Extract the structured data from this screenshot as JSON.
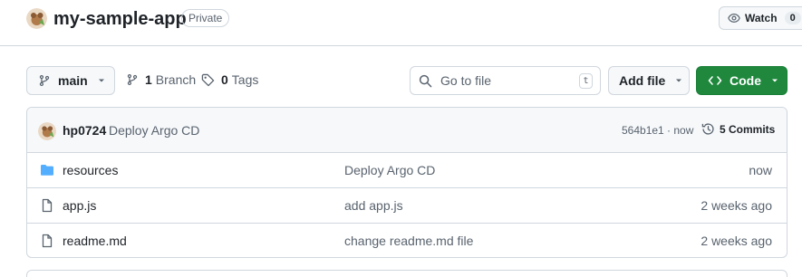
{
  "repo": {
    "name": "my-sample-app",
    "visibility": "Private",
    "watch_label": "Watch",
    "watch_count": "0"
  },
  "toolbar": {
    "branch": "main",
    "branch_count": "1",
    "branch_word": "Branch",
    "tag_count": "0",
    "tag_word": "Tags",
    "search_placeholder": "Go to file",
    "search_shortcut": "t",
    "add_file_label": "Add file",
    "code_label": "Code"
  },
  "latest_commit": {
    "author": "hp0724",
    "message": "Deploy Argo CD",
    "sha_time": "564b1e1 · now",
    "commits_label": "5 Commits"
  },
  "files": [
    {
      "type": "folder",
      "icon": "folder-icon",
      "name": "resources",
      "message": "Deploy Argo CD",
      "age": "now"
    },
    {
      "type": "file",
      "icon": "file-icon",
      "name": "app.js",
      "message": "add app.js",
      "age": "2 weeks ago"
    },
    {
      "type": "file",
      "icon": "file-icon",
      "name": "readme.md",
      "message": "change readme.md file",
      "age": "2 weeks ago"
    }
  ],
  "colors": {
    "accent_green": "#1f883d",
    "folder_blue": "#54aeff",
    "border": "#d0d7de",
    "muted_text": "#59636e"
  }
}
